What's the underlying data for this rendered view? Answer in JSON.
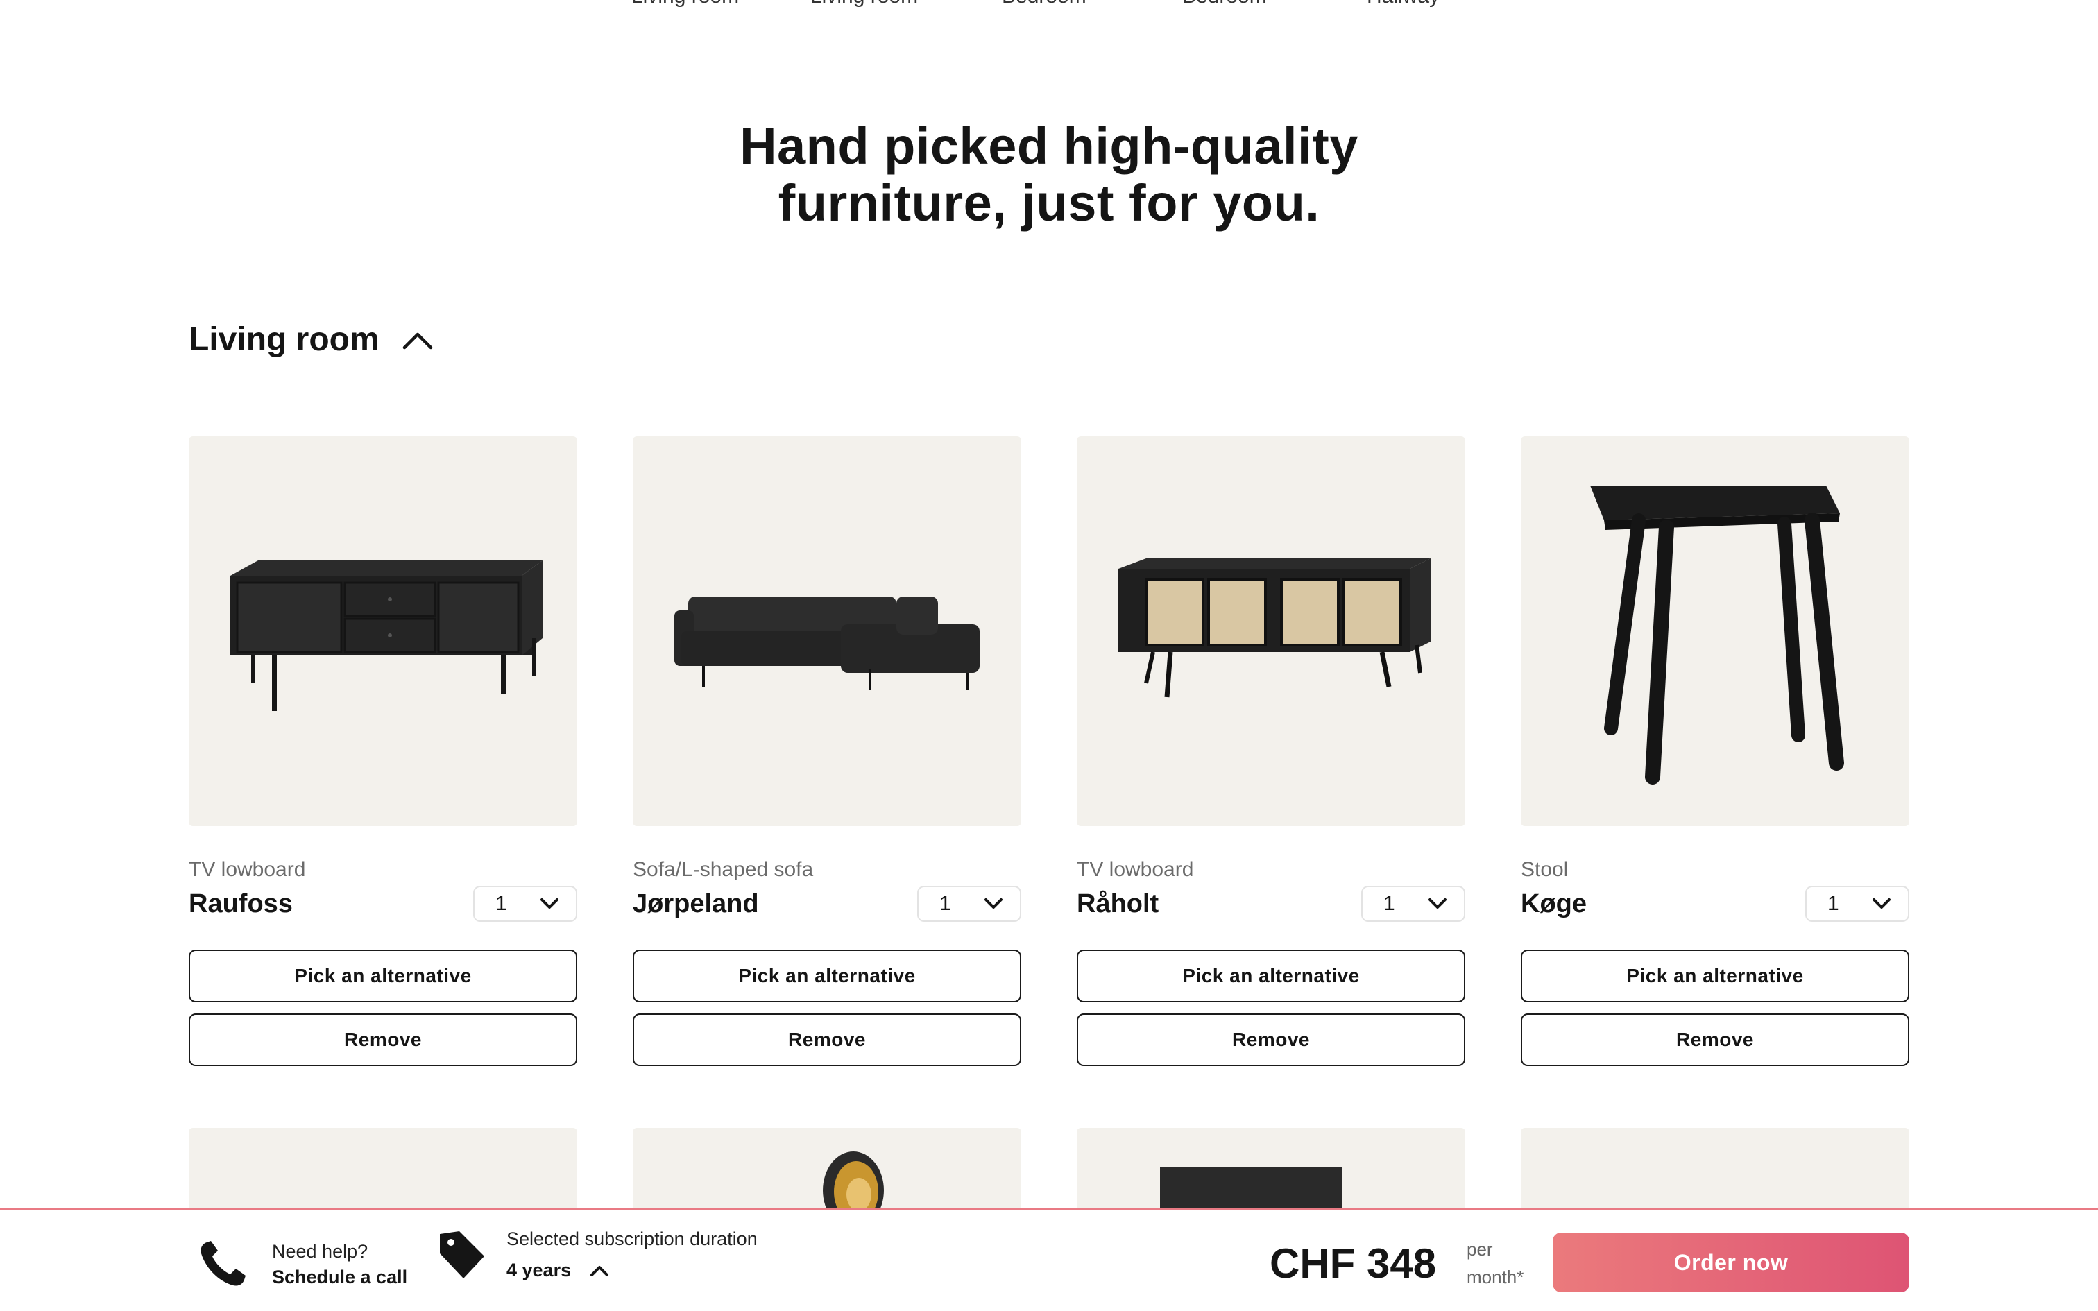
{
  "top_tabs": [
    "Living room",
    "Living room",
    "Bedroom",
    "Bedroom",
    "Hallway"
  ],
  "headline": {
    "line1": "Hand picked high-quality",
    "line2": "furniture, just for you."
  },
  "section": {
    "title": "Living room",
    "chevron_icon": "chevron-up-icon"
  },
  "products": [
    {
      "category": "TV lowboard",
      "name": "Raufoss",
      "quantity": "1",
      "alt_label": "Pick an alternative",
      "remove_label": "Remove",
      "image_icon": "tv-lowboard-image"
    },
    {
      "category": "Sofa/L-shaped sofa",
      "name": "Jørpeland",
      "quantity": "1",
      "alt_label": "Pick an alternative",
      "remove_label": "Remove",
      "image_icon": "sofa-image"
    },
    {
      "category": "TV lowboard",
      "name": "Råholt",
      "quantity": "1",
      "alt_label": "Pick an alternative",
      "remove_label": "Remove",
      "image_icon": "rattan-lowboard-image"
    },
    {
      "category": "Stool",
      "name": "Køge",
      "quantity": "1",
      "alt_label": "Pick an alternative",
      "remove_label": "Remove",
      "image_icon": "stool-image"
    }
  ],
  "bottom_bar": {
    "help_line1": "Need help?",
    "help_line2": "Schedule a call",
    "subscription_label": "Selected subscription duration",
    "subscription_value": "4 years",
    "price": "CHF 348",
    "per_line1": "per",
    "per_line2": "month*",
    "order_label": "Order now"
  },
  "colors": {
    "card_bg": "#f3f1ec",
    "accent_start": "#eb7a7c",
    "accent_end": "#de5474",
    "bar_border": "#e97a84"
  }
}
